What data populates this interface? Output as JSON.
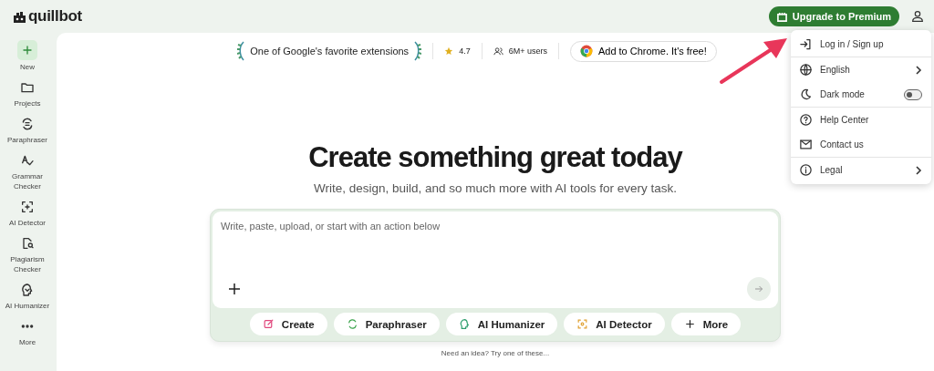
{
  "header": {
    "logo": "quillbot",
    "upgrade_button": "Upgrade to Premium"
  },
  "sidebar": {
    "items": [
      {
        "label": "New",
        "kind": "new"
      },
      {
        "label": "Projects",
        "kind": "folder"
      },
      {
        "label": "Paraphraser",
        "kind": "paraphraser"
      },
      {
        "label": "Grammar Checker",
        "kind": "grammar"
      },
      {
        "label": "AI Detector",
        "kind": "detector"
      },
      {
        "label": "Plagiarism Checker",
        "kind": "plagiarism"
      },
      {
        "label": "AI Humanizer",
        "kind": "humanizer"
      },
      {
        "label": "More",
        "kind": "more"
      }
    ]
  },
  "promo": {
    "award": "One of Google's favorite extensions",
    "rating": "4.7",
    "users": "6M+ users",
    "chrome_button": "Add to Chrome. It's free!"
  },
  "hero": {
    "title": "Create something great today",
    "subtitle": "Write, design, build, and so much more with AI tools for every task."
  },
  "composer": {
    "placeholder": "Write, paste, upload, or start with an action below",
    "actions": [
      {
        "label": "Create",
        "kind": "create"
      },
      {
        "label": "Paraphraser",
        "kind": "paraphraser"
      },
      {
        "label": "AI Humanizer",
        "kind": "humanizer"
      },
      {
        "label": "AI Detector",
        "kind": "detector"
      },
      {
        "label": "More",
        "kind": "more"
      }
    ]
  },
  "hint": "Need an idea? Try one of these...",
  "account_menu": {
    "items": [
      {
        "label": "Log in / Sign up",
        "kind": "login",
        "divider_after": true
      },
      {
        "label": "English",
        "kind": "language",
        "divider_after": false
      },
      {
        "label": "Dark mode",
        "kind": "darkmode",
        "on": false,
        "divider_after": true
      },
      {
        "label": "Help Center",
        "kind": "help",
        "divider_after": false
      },
      {
        "label": "Contact us",
        "kind": "contact",
        "divider_after": true
      },
      {
        "label": "Legal",
        "kind": "legal",
        "divider_after": false
      }
    ]
  }
}
